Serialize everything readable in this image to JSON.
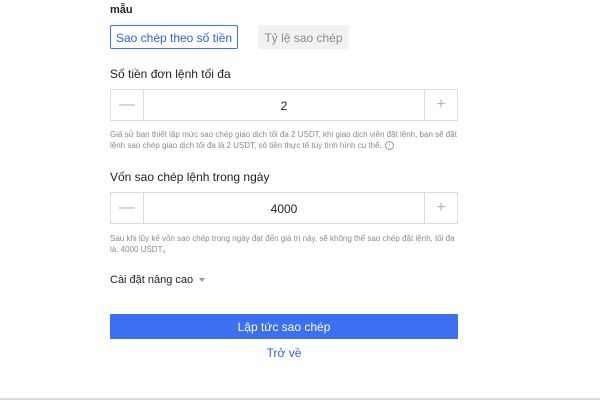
{
  "header": {
    "mau_label": "mẫu"
  },
  "tabs": [
    {
      "label": "Sao chép theo số tiền",
      "active": true
    },
    {
      "label": "Tỷ lệ sao chép",
      "active": false
    }
  ],
  "max_amount": {
    "label": "Số tiền đơn lệnh tối đa",
    "value": "2",
    "minus_symbol": "—",
    "plus_symbol": "+",
    "hint": "Giả sử bạn thiết lập mức sao chép giao dịch tối đa 2 USDT, khi giao dịch viên đặt lệnh, bạn sẽ đặt lệnh sao chép giao dịch tối đa là 2 USDT, số tiền thực tế tùy tình hình cụ thể.",
    "info_symbol": "i"
  },
  "daily_capital": {
    "label": "Vốn sao chép lệnh trong ngày",
    "value": "4000",
    "minus_symbol": "—",
    "plus_symbol": "+",
    "hint": "Sau khi lũy kế vốn sao chép trong ngày đạt đến giá trị này, sẽ không thể sao chép đặt lệnh, tối đa là:  4000 USDT。"
  },
  "advanced": {
    "label": "Cài đặt nâng cao"
  },
  "actions": {
    "copy_now": "Lập tức sao chép",
    "back": "Trở về"
  },
  "colors": {
    "accent": "#3d6ff3",
    "muted": "#8a8a8a",
    "border": "#dcdcdc"
  }
}
